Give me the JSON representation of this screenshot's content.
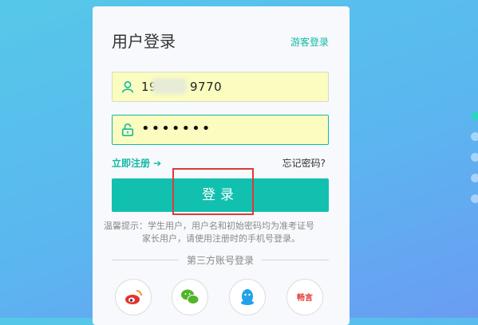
{
  "login": {
    "title": "用户登录",
    "guest_link": "游客登录",
    "username_value_start": "19",
    "username_value_end": "9770",
    "password_value": "•••••••",
    "register_link": "立即注册 ➔",
    "forgot_link": "忘记密码?",
    "submit_label": "登录",
    "hint_line1": "温馨提示：学生用户，用户名和初始密码均为准考证号",
    "hint_line2": "家长用户，请使用注册时的手机号登录。",
    "third_party_label": "第三方账号登录"
  },
  "social": [
    {
      "name": "weibo",
      "icon": "weibo-icon",
      "color": "#e6322d"
    },
    {
      "name": "wechat",
      "icon": "wechat-icon",
      "color": "#51b52a"
    },
    {
      "name": "qq",
      "icon": "qq-icon",
      "color": "#22a3e8"
    },
    {
      "name": "chang-yan",
      "icon": "changyan-icon",
      "label": "畅言",
      "color": "#e0403c"
    }
  ],
  "colors": {
    "accent": "#12c0b0",
    "highlight": "#dc3b3b"
  }
}
